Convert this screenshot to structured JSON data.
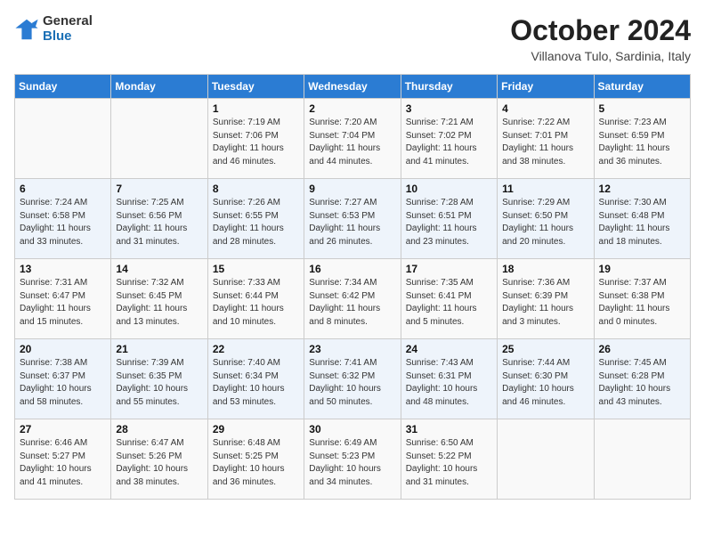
{
  "header": {
    "logo_general": "General",
    "logo_blue": "Blue",
    "month_title": "October 2024",
    "subtitle": "Villanova Tulo, Sardinia, Italy"
  },
  "days_of_week": [
    "Sunday",
    "Monday",
    "Tuesday",
    "Wednesday",
    "Thursday",
    "Friday",
    "Saturday"
  ],
  "weeks": [
    [
      {
        "day": "",
        "info": ""
      },
      {
        "day": "",
        "info": ""
      },
      {
        "day": "1",
        "info": "Sunrise: 7:19 AM\nSunset: 7:06 PM\nDaylight: 11 hours and 46 minutes."
      },
      {
        "day": "2",
        "info": "Sunrise: 7:20 AM\nSunset: 7:04 PM\nDaylight: 11 hours and 44 minutes."
      },
      {
        "day": "3",
        "info": "Sunrise: 7:21 AM\nSunset: 7:02 PM\nDaylight: 11 hours and 41 minutes."
      },
      {
        "day": "4",
        "info": "Sunrise: 7:22 AM\nSunset: 7:01 PM\nDaylight: 11 hours and 38 minutes."
      },
      {
        "day": "5",
        "info": "Sunrise: 7:23 AM\nSunset: 6:59 PM\nDaylight: 11 hours and 36 minutes."
      }
    ],
    [
      {
        "day": "6",
        "info": "Sunrise: 7:24 AM\nSunset: 6:58 PM\nDaylight: 11 hours and 33 minutes."
      },
      {
        "day": "7",
        "info": "Sunrise: 7:25 AM\nSunset: 6:56 PM\nDaylight: 11 hours and 31 minutes."
      },
      {
        "day": "8",
        "info": "Sunrise: 7:26 AM\nSunset: 6:55 PM\nDaylight: 11 hours and 28 minutes."
      },
      {
        "day": "9",
        "info": "Sunrise: 7:27 AM\nSunset: 6:53 PM\nDaylight: 11 hours and 26 minutes."
      },
      {
        "day": "10",
        "info": "Sunrise: 7:28 AM\nSunset: 6:51 PM\nDaylight: 11 hours and 23 minutes."
      },
      {
        "day": "11",
        "info": "Sunrise: 7:29 AM\nSunset: 6:50 PM\nDaylight: 11 hours and 20 minutes."
      },
      {
        "day": "12",
        "info": "Sunrise: 7:30 AM\nSunset: 6:48 PM\nDaylight: 11 hours and 18 minutes."
      }
    ],
    [
      {
        "day": "13",
        "info": "Sunrise: 7:31 AM\nSunset: 6:47 PM\nDaylight: 11 hours and 15 minutes."
      },
      {
        "day": "14",
        "info": "Sunrise: 7:32 AM\nSunset: 6:45 PM\nDaylight: 11 hours and 13 minutes."
      },
      {
        "day": "15",
        "info": "Sunrise: 7:33 AM\nSunset: 6:44 PM\nDaylight: 11 hours and 10 minutes."
      },
      {
        "day": "16",
        "info": "Sunrise: 7:34 AM\nSunset: 6:42 PM\nDaylight: 11 hours and 8 minutes."
      },
      {
        "day": "17",
        "info": "Sunrise: 7:35 AM\nSunset: 6:41 PM\nDaylight: 11 hours and 5 minutes."
      },
      {
        "day": "18",
        "info": "Sunrise: 7:36 AM\nSunset: 6:39 PM\nDaylight: 11 hours and 3 minutes."
      },
      {
        "day": "19",
        "info": "Sunrise: 7:37 AM\nSunset: 6:38 PM\nDaylight: 11 hours and 0 minutes."
      }
    ],
    [
      {
        "day": "20",
        "info": "Sunrise: 7:38 AM\nSunset: 6:37 PM\nDaylight: 10 hours and 58 minutes."
      },
      {
        "day": "21",
        "info": "Sunrise: 7:39 AM\nSunset: 6:35 PM\nDaylight: 10 hours and 55 minutes."
      },
      {
        "day": "22",
        "info": "Sunrise: 7:40 AM\nSunset: 6:34 PM\nDaylight: 10 hours and 53 minutes."
      },
      {
        "day": "23",
        "info": "Sunrise: 7:41 AM\nSunset: 6:32 PM\nDaylight: 10 hours and 50 minutes."
      },
      {
        "day": "24",
        "info": "Sunrise: 7:43 AM\nSunset: 6:31 PM\nDaylight: 10 hours and 48 minutes."
      },
      {
        "day": "25",
        "info": "Sunrise: 7:44 AM\nSunset: 6:30 PM\nDaylight: 10 hours and 46 minutes."
      },
      {
        "day": "26",
        "info": "Sunrise: 7:45 AM\nSunset: 6:28 PM\nDaylight: 10 hours and 43 minutes."
      }
    ],
    [
      {
        "day": "27",
        "info": "Sunrise: 6:46 AM\nSunset: 5:27 PM\nDaylight: 10 hours and 41 minutes."
      },
      {
        "day": "28",
        "info": "Sunrise: 6:47 AM\nSunset: 5:26 PM\nDaylight: 10 hours and 38 minutes."
      },
      {
        "day": "29",
        "info": "Sunrise: 6:48 AM\nSunset: 5:25 PM\nDaylight: 10 hours and 36 minutes."
      },
      {
        "day": "30",
        "info": "Sunrise: 6:49 AM\nSunset: 5:23 PM\nDaylight: 10 hours and 34 minutes."
      },
      {
        "day": "31",
        "info": "Sunrise: 6:50 AM\nSunset: 5:22 PM\nDaylight: 10 hours and 31 minutes."
      },
      {
        "day": "",
        "info": ""
      },
      {
        "day": "",
        "info": ""
      }
    ]
  ]
}
